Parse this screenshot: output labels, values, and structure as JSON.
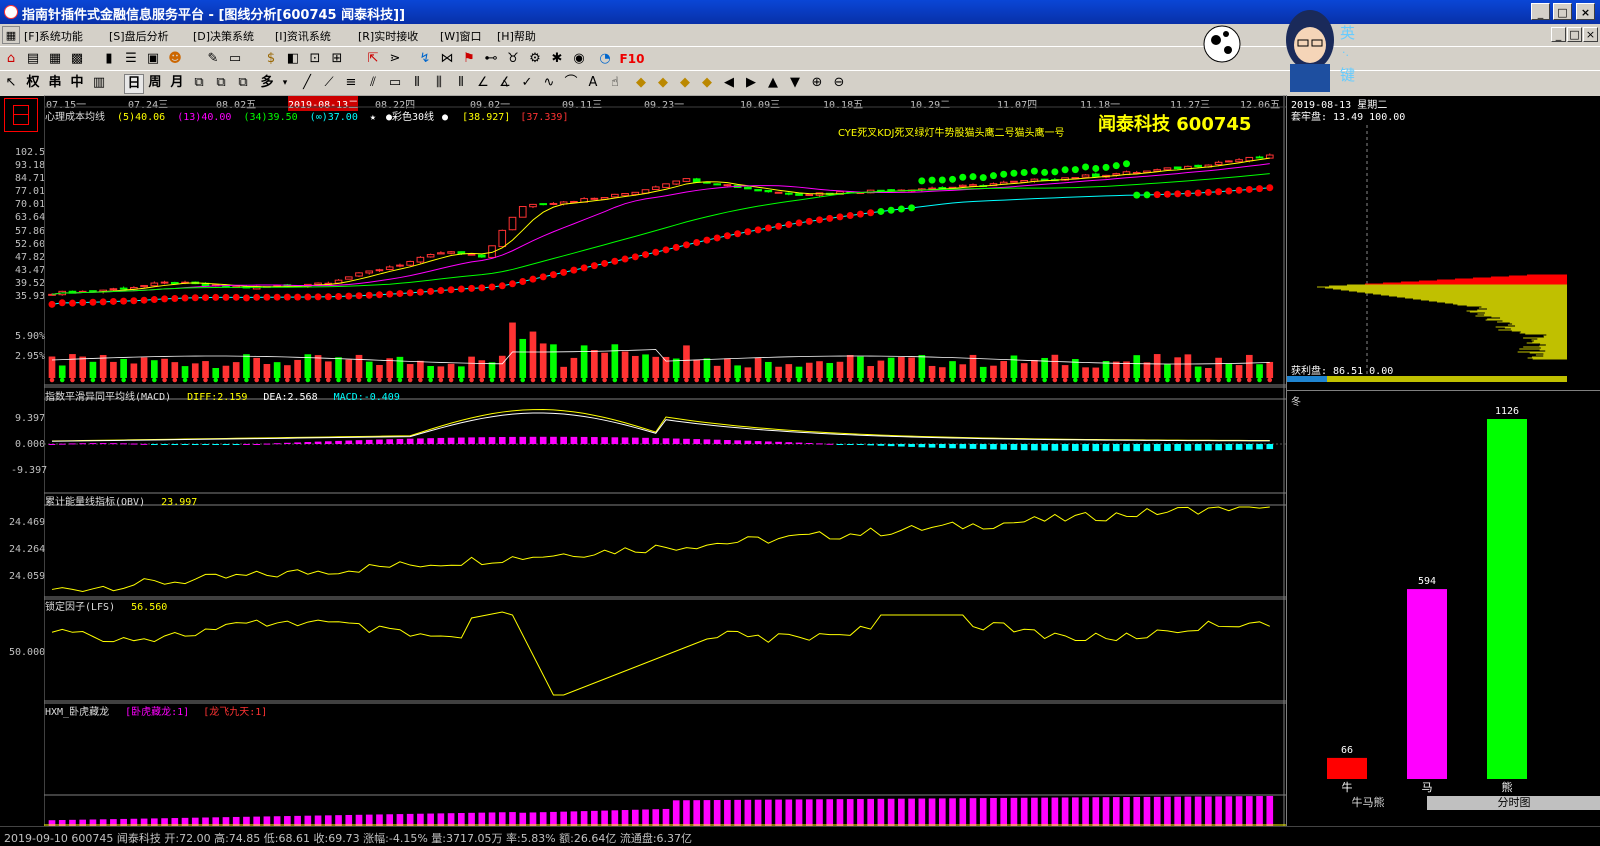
{
  "window": {
    "title": "指南针插件式金融信息服务平台 - [图线分析[600745 闻泰科技]]",
    "min": "_",
    "max": "□",
    "close": "×",
    "child_min": "_",
    "child_restore": "□",
    "child_close": "×"
  },
  "menu": [
    {
      "label": "[F]系统功能"
    },
    {
      "label": "[S]盘后分析"
    },
    {
      "label": "[D]决策系统"
    },
    {
      "label": "[I]资讯系统"
    },
    {
      "label": "[R]实时接收"
    },
    {
      "label": "[W]窗口"
    },
    {
      "label": "[H]帮助"
    }
  ],
  "toolbar2": {
    "period_day": "日",
    "period_week": "周",
    "period_month": "月",
    "more": "多",
    "f10": "F10"
  },
  "toolbar3": {
    "quan": "权",
    "chuan": "串",
    "zhong": "中"
  },
  "overlay_text": {
    "ying": "英",
    "dots": "·.",
    "jian": "键"
  },
  "date_axis": [
    "07.15一",
    "07.24三",
    "08.02五",
    "2019-08-13二",
    "08.22四",
    "09.02一",
    "09.11三",
    "09.23一",
    "10.09三",
    "10.18五",
    "10.29二",
    "11.07四",
    "11.18一",
    "11.27三",
    "12.06五"
  ],
  "main_panel": {
    "indicator": "心理成本均线",
    "ma5": "(5)40.06",
    "ma13": "(13)40.00",
    "ma34": "(34)39.50",
    "mainf": "(∞)37.00",
    "star": "★",
    "dot": "●",
    "caise": "彩色30线",
    "v1": "[38.927]",
    "v2": "[37.339]",
    "signals": "CYE死叉KDJ死叉绿灯牛势股猫头鹰二号猫头鹰一号",
    "stock": "闻泰科技 600745",
    "yaxis": [
      "102.5",
      "93.18",
      "84.71",
      "77.01",
      "70.01",
      "63.64",
      "57.86",
      "52.60",
      "47.82",
      "43.47",
      "39.52",
      "35.93"
    ],
    "vol_axis": [
      "5.90%",
      "2.95%"
    ]
  },
  "macd_panel": {
    "name": "指数平滑异同平均线(MACD)",
    "diff": "DIFF:2.159",
    "dea": "DEA:2.568",
    "macd": "MACD:-0.409",
    "yaxis": [
      "9.397",
      "0.000",
      "-9.397"
    ]
  },
  "obv_panel": {
    "name": "累计能量线指标(OBV)",
    "value": "23.997",
    "yaxis": [
      "24.469",
      "24.264",
      "24.059"
    ]
  },
  "lfs_panel": {
    "name": "锁定因子(LFS)",
    "value": "56.560",
    "yaxis": [
      "50.000"
    ]
  },
  "hxm_panel": {
    "name": "HXM_卧虎藏龙",
    "v1": "[卧虎藏龙:1]",
    "v2": "[龙飞九天:1]"
  },
  "chip_panel": {
    "date": "2019-08-13 星期二",
    "lock": "套牢盘: 13.49 100.00",
    "profit": "获利盘: 86.51 0.00"
  },
  "cattle": {
    "header": "冬",
    "bars": [
      {
        "label": "牛",
        "value": 66,
        "value_text": "66",
        "color": "#ff0000"
      },
      {
        "label": "马",
        "value": 594,
        "value_text": "594",
        "color": "#ff00ff"
      },
      {
        "label": "熊",
        "value": 1126,
        "value_text": "1126",
        "color": "#00ff00"
      }
    ],
    "tab1": "牛马熊",
    "tab2": "分时图"
  },
  "status": "2019-09-10 600745  闻泰科技  开:72.00  高:74.85  低:68.61  收:69.73  涨幅:-4.15%  量:3717.05万  率:5.83%  额:26.64亿  流通盘:6.37亿",
  "chart_data": [
    {
      "type": "line",
      "title": "心理成本均线",
      "yscale": "log",
      "ylim": [
        35.93,
        102.5
      ],
      "x_labels": [
        "07.15一",
        "07.24三",
        "08.02五",
        "2019-08-13二",
        "08.22四",
        "09.02一",
        "09.11三",
        "09.23一",
        "10.09三",
        "10.18五",
        "10.29二",
        "11.07四",
        "11.18一",
        "11.27三",
        "12.06五"
      ],
      "close_anchors": [
        37,
        37.5,
        38.5,
        40,
        39,
        38.5,
        39,
        40,
        43,
        46,
        50,
        48,
        70,
        72,
        74,
        78,
        85,
        82,
        78,
        76,
        77,
        78,
        79,
        80,
        82,
        84,
        86,
        88,
        90,
        93,
        97,
        100
      ]
    },
    {
      "type": "bar",
      "title": "指数平滑异同平均线(MACD)",
      "ylim": [
        -9.397,
        9.397
      ],
      "series": [
        {
          "name": "DIFF",
          "last": 2.159
        },
        {
          "name": "DEA",
          "last": 2.568
        },
        {
          "name": "MACD",
          "last": -0.409
        }
      ]
    },
    {
      "type": "line",
      "title": "累计能量线指标(OBV)",
      "ylim": [
        24.0,
        24.5
      ],
      "last": 23.997
    },
    {
      "type": "line",
      "title": "锁定因子(LFS)",
      "last": 56.56
    },
    {
      "type": "bar",
      "title": "牛马熊",
      "categories": [
        "牛",
        "马",
        "熊"
      ],
      "values": [
        66,
        594,
        1126
      ]
    }
  ]
}
